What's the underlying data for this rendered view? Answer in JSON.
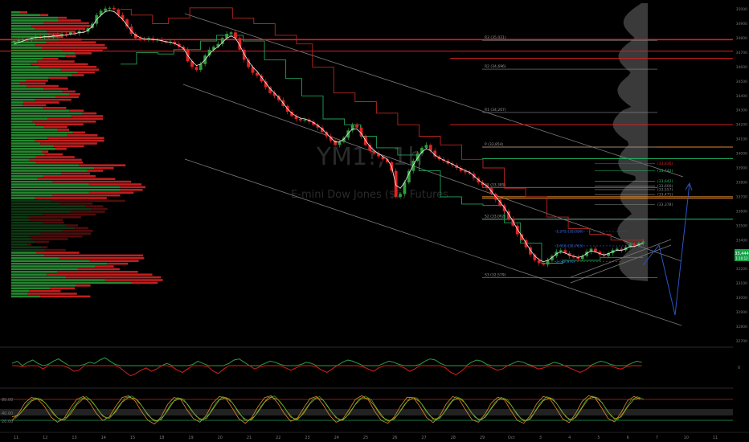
{
  "watermark": {
    "symbol": "YM1!, 1h",
    "name": "E-mini Dow Jones ($5) Futures"
  },
  "colors": {
    "background": "#000000",
    "bull": "#2e9e3a",
    "bear": "#e02424",
    "resistance": "#d92020",
    "support": "#1fbf6a",
    "orange_line": "#e08a2a",
    "channel": "#8a8a8a",
    "projection": "#2a55c8",
    "price_tag": "#17a34a"
  },
  "chart_data": {
    "type": "line",
    "price_axis": {
      "ticks": [
        "35000",
        "34900",
        "34800",
        "34700",
        "34600",
        "34500",
        "34400",
        "34300",
        "34200",
        "34100",
        "34000",
        "33900",
        "33800",
        "33700",
        "33600",
        "33500",
        "33400",
        "33300",
        "33200",
        "33100",
        "33000",
        "32900",
        "32800",
        "32700"
      ],
      "range": [
        32680,
        35020
      ]
    },
    "time_axis": {
      "ticks": [
        "11",
        "12",
        "13",
        "14",
        "15",
        "18",
        "19",
        "20",
        "21",
        "22",
        "23",
        "24",
        "25",
        "26",
        "27",
        "28",
        "29",
        "Oct",
        "3",
        "4",
        "5",
        "6",
        "7",
        "10",
        "11"
      ]
    },
    "close": [
      34780,
      34785,
      34792,
      34790,
      34800,
      34810,
      34805,
      34812,
      34808,
      34820,
      34815,
      34830,
      34825,
      34840,
      34832,
      34850,
      34845,
      34870,
      34900,
      34960,
      34990,
      35005,
      35010,
      35000,
      34960,
      34930,
      34880,
      34830,
      34800,
      34795,
      34790,
      34800,
      34785,
      34790,
      34780,
      34770,
      34775,
      34760,
      34740,
      34720,
      34640,
      34600,
      34580,
      34620,
      34680,
      34720,
      34740,
      34760,
      34800,
      34830,
      34840,
      34800,
      34720,
      34650,
      34600,
      34560,
      34540,
      34500,
      34460,
      34420,
      34400,
      34370,
      34330,
      34290,
      34260,
      34240,
      34230,
      34235,
      34220,
      34200,
      34180,
      34150,
      34120,
      34090,
      34060,
      34080,
      34110,
      34160,
      34200,
      34180,
      34120,
      34060,
      34020,
      34000,
      33980,
      33960,
      33940,
      33880,
      33700,
      33720,
      33800,
      33880,
      33950,
      34000,
      34040,
      34060,
      34020,
      33980,
      33960,
      33950,
      33930,
      33920,
      33900,
      33880,
      33870,
      33860,
      33830,
      33800,
      33780,
      33760,
      33720,
      33680,
      33640,
      33600,
      33550,
      33500,
      33440,
      33400,
      33350,
      33300,
      33260,
      33240,
      33230,
      33260,
      33290,
      33320,
      33330,
      33310,
      33290,
      33280,
      33270,
      33290,
      33320,
      33340,
      33320,
      33300,
      33290,
      33310,
      33330,
      33340,
      33330,
      33350,
      33370,
      33360,
      33380,
      33390
    ],
    "vwap": [
      34760,
      34770,
      34780,
      34790,
      34800,
      34805,
      34805,
      34810,
      34810,
      34815,
      34815,
      34820,
      34820,
      34830,
      34830,
      34840,
      34840,
      34855,
      34880,
      34930,
      34960,
      34985,
      34990,
      34985,
      34960,
      34930,
      34890,
      34850,
      34820,
      34805,
      34795,
      34795,
      34790,
      34788,
      34782,
      34775,
      34772,
      34762,
      34748,
      34730,
      34680,
      34640,
      34610,
      34620,
      34650,
      34690,
      34720,
      34740,
      34770,
      34800,
      34815,
      34800,
      34750,
      34690,
      34640,
      34600,
      34570,
      34530,
      34490,
      34450,
      34420,
      34390,
      34350,
      34310,
      34280,
      34260,
      34245,
      34240,
      34230,
      34215,
      34195,
      34170,
      34140,
      34110,
      34080,
      34080,
      34100,
      34140,
      34170,
      34170,
      34140,
      34090,
      34050,
      34020,
      34000,
      33980,
      33960,
      33910,
      33780,
      33760,
      33800,
      33860,
      33920,
      33970,
      34010,
      34035,
      34020,
      33990,
      33970,
      33955,
      33940,
      33928,
      33910,
      33895,
      33882,
      33870,
      33845,
      33818,
      33795,
      33775,
      33740,
      33700,
      33665,
      33625,
      33580,
      33530,
      33475,
      33430,
      33380,
      33330,
      33290,
      33265,
      33250,
      33260,
      33280,
      33305,
      33318,
      33310,
      33298,
      33288,
      33280,
      33288,
      33308,
      33325,
      33318,
      33306,
      33298,
      33306,
      33320,
      33330,
      33328,
      33340,
      33355,
      33356,
      33368,
      33378
    ],
    "support_steps": [
      34620,
      34620,
      34620,
      34700,
      34700,
      34700,
      34700,
      34690,
      34690,
      34690,
      34720,
      34720,
      34720,
      34720,
      34720,
      34780,
      34780,
      34780,
      34820,
      34820,
      34820,
      34820,
      34820,
      34780,
      34780,
      34780,
      34780,
      34650,
      34650,
      34650,
      34650,
      34520,
      34520,
      34520,
      34400,
      34400,
      34400,
      34400,
      34240,
      34240,
      34240,
      34240,
      34200,
      34200,
      34200,
      34120,
      34120,
      34120,
      34040,
      34040,
      34040,
      34040,
      33990,
      33990,
      33990,
      33990,
      33880,
      33880,
      33880,
      33880,
      33700,
      33700,
      33700,
      33700,
      33650,
      33650,
      33650,
      33650,
      33640,
      33640,
      33640,
      33640,
      33520,
      33520,
      33520,
      33380,
      33380,
      33380,
      33380,
      33240,
      33240,
      33240,
      33240,
      33260,
      33260,
      33260,
      33260,
      33260,
      33260,
      33260,
      33280,
      33280,
      33280,
      33280,
      33280,
      33280,
      33280,
      33280
    ],
    "resistance_steps": [
      35000,
      35000,
      34960,
      34960,
      34960,
      34960,
      34900,
      34900,
      34900,
      34940,
      34940,
      34940,
      34940,
      35010,
      35010,
      35010,
      35010,
      35010,
      35010,
      35010,
      35010,
      34940,
      34940,
      34940,
      34940,
      34900,
      34900,
      34900,
      34900,
      34820,
      34820,
      34820,
      34820,
      34760,
      34760,
      34760,
      34600,
      34600,
      34600,
      34600,
      34420,
      34420,
      34420,
      34420,
      34360,
      34360,
      34360,
      34360,
      34280,
      34280,
      34280,
      34280,
      34200,
      34200,
      34200,
      34200,
      34120,
      34120,
      34120,
      34120,
      34060,
      34060,
      34060,
      34060,
      33960,
      33960,
      33960,
      33960,
      33900,
      33900,
      33900,
      33900,
      33760,
      33760,
      33760,
      33760,
      33700,
      33700,
      33700,
      33700,
      33560,
      33560,
      33560,
      33560,
      33480,
      33480,
      33480,
      33480,
      33440,
      33440,
      33440,
      33440,
      33400,
      33400,
      33400,
      33400,
      33400,
      33400
    ],
    "pivot_levels": [
      {
        "label": "R3 (35,021)",
        "price": 34785
      },
      {
        "label": "R2 (34,696)",
        "price": 34585
      },
      {
        "label": "R1 (34,207)",
        "price": 34285
      },
      {
        "label": "P (33,854)",
        "price": 34045
      },
      {
        "label": "S1 (33,385)",
        "price": 33765
      },
      {
        "label": "S2 (33,062)",
        "price": 33545
      },
      {
        "label": "S3 (32,579)",
        "price": 33140
      }
    ],
    "fib_levels": [
      {
        "label": "1.272 (33,026)",
        "price": 33460
      },
      {
        "label": "1.618 (32,763)",
        "price": 33360
      },
      {
        "label": "2 (32,475)",
        "price": 33250
      }
    ],
    "right_levels": [
      {
        "label": "(33,836)",
        "price": 33930
      },
      {
        "label": "(33,742)",
        "price": 33880
      },
      {
        "label": "(33,642)",
        "price": 33808
      },
      {
        "label": "(33,600)",
        "price": 33775
      },
      {
        "label": "(33,557)",
        "price": 33750
      },
      {
        "label": "(33,471)",
        "price": 33715
      },
      {
        "label": "(33,378)",
        "price": 33648
      }
    ],
    "current_price": {
      "label": "33,444",
      "sub": "1:10:12",
      "price": 33745
    },
    "horizontal_lines": [
      {
        "color": "red",
        "price": 34790
      },
      {
        "color": "red",
        "price": 34710
      },
      {
        "color": "red",
        "price": 34660
      },
      {
        "color": "red",
        "price": 34200
      },
      {
        "color": "orange",
        "price": 34045
      },
      {
        "color": "green",
        "price": 33965
      },
      {
        "color": "orange",
        "price": 33700
      },
      {
        "color": "orange",
        "price": 33690
      },
      {
        "color": "green",
        "price": 33545
      }
    ],
    "oscillator": [
      0.2,
      0.4,
      -0.1,
      0.3,
      0.5,
      0.2,
      -0.3,
      0.1,
      0.4,
      0.6,
      0.3,
      -0.2,
      -0.5,
      -0.4,
      0.1,
      0.3,
      0.2,
      0.5,
      0.7,
      0.4,
      0.1,
      -0.2,
      -0.6,
      -0.9,
      -0.7,
      -0.4,
      -0.2,
      -0.5,
      -0.3,
      0.0,
      0.2,
      -0.1,
      -0.4,
      -0.6,
      -0.3,
      0.1,
      0.4,
      0.2,
      -0.1,
      -0.5,
      -0.7,
      -0.3,
      0.2,
      0.5,
      0.6,
      0.3,
      0.0,
      -0.3,
      -0.1,
      0.2,
      0.4,
      0.3,
      0.1,
      -0.2,
      -0.4,
      -0.2,
      0.1,
      0.3,
      0.2,
      -0.1,
      -0.4,
      -0.6,
      -0.3,
      0.0,
      0.3,
      0.5,
      0.4,
      0.2,
      -0.1,
      -0.3,
      -0.5,
      -0.2,
      0.2,
      0.4,
      0.3,
      0.1,
      -0.2,
      -0.5,
      -0.3,
      0.1,
      0.4,
      0.6,
      0.5,
      0.2,
      -0.2,
      -0.6,
      -0.8,
      -0.5,
      -0.1,
      0.3,
      0.5,
      0.4,
      0.1,
      -0.2,
      -0.4,
      -0.3,
      0.0,
      0.2,
      0.4,
      0.3,
      0.1,
      -0.1,
      -0.3,
      -0.2,
      0.1,
      0.3,
      0.2,
      0.0,
      -0.2,
      -0.4,
      -0.6,
      -0.4,
      -0.1,
      0.2,
      0.4,
      0.3,
      0.1,
      -0.2,
      -0.3,
      -0.1,
      0.2,
      0.4,
      0.3
    ],
    "stoch_k": [
      20,
      40,
      70,
      85,
      80,
      60,
      30,
      15,
      25,
      55,
      80,
      88,
      70,
      40,
      20,
      30,
      60,
      85,
      90,
      75,
      45,
      20,
      10,
      30,
      65,
      85,
      80,
      50,
      25,
      15,
      35,
      70,
      88,
      82,
      55,
      25,
      12,
      28,
      60,
      85,
      90,
      70,
      40,
      18,
      25,
      55,
      82,
      88,
      65,
      35,
      15,
      22,
      50,
      80,
      90,
      78,
      45,
      20,
      12,
      30,
      62,
      86,
      84,
      58,
      28,
      14,
      32,
      66,
      88,
      80,
      50,
      22,
      15,
      38,
      70,
      86,
      78,
      48,
      20,
      12,
      34,
      68,
      88,
      82,
      54,
      24,
      14,
      40,
      74,
      90,
      84,
      56,
      26,
      16,
      42,
      76,
      88,
      80
    ],
    "stoch_d": [
      30,
      35,
      55,
      75,
      82,
      72,
      50,
      28,
      20,
      38,
      65,
      82,
      80,
      58,
      32,
      26,
      45,
      72,
      85,
      82,
      62,
      35,
      18,
      22,
      48,
      75,
      82,
      68,
      42,
      22,
      26,
      52,
      78,
      85,
      70,
      42,
      20,
      22,
      45,
      72,
      86,
      80,
      58,
      30,
      22,
      40,
      68,
      84,
      78,
      52,
      28,
      20,
      38,
      65,
      84,
      82,
      60,
      32,
      18,
      24,
      48,
      74,
      84,
      72,
      45,
      24,
      26,
      50,
      76,
      84,
      68,
      40,
      22,
      28,
      54,
      78,
      82,
      64,
      36,
      18,
      24,
      52,
      76,
      84,
      70,
      42,
      22,
      28,
      56,
      82,
      86,
      72,
      44,
      24,
      30,
      58,
      80,
      84
    ]
  }
}
